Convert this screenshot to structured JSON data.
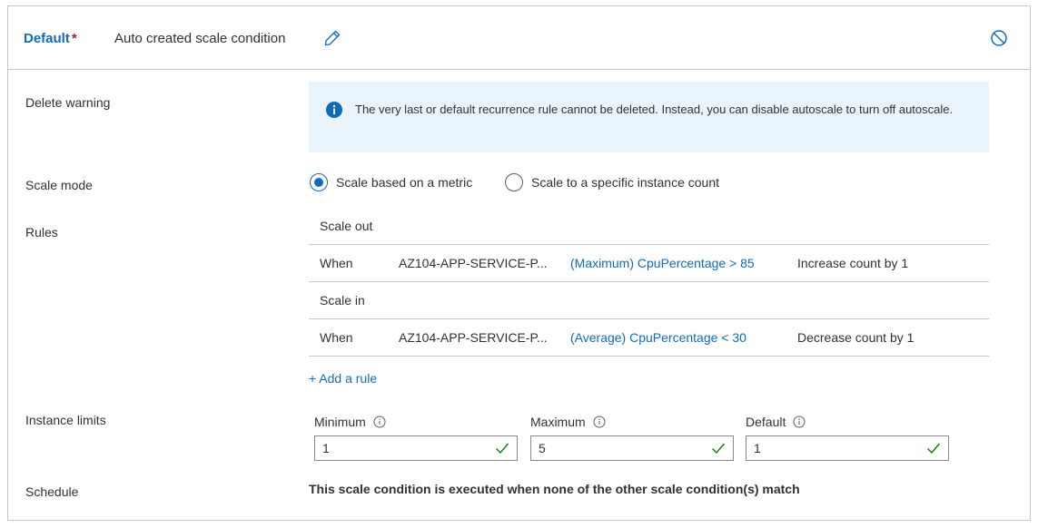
{
  "header": {
    "title": "Default",
    "required_mark": "*",
    "condition_name": "Auto created scale condition"
  },
  "labels": {
    "delete_warning": "Delete warning",
    "scale_mode": "Scale mode",
    "rules": "Rules",
    "instance_limits": "Instance limits",
    "schedule": "Schedule"
  },
  "warning": {
    "text": "The very last or default recurrence rule cannot be deleted. Instead, you can disable autoscale to turn off autoscale."
  },
  "scale_mode": {
    "options": [
      {
        "label": "Scale based on a metric",
        "selected": true
      },
      {
        "label": "Scale to a specific instance count",
        "selected": false
      }
    ]
  },
  "rules": {
    "scale_out": {
      "heading": "Scale out",
      "when": "When",
      "resource": "AZ104-APP-SERVICE-P...",
      "metric": "(Maximum) CpuPercentage > 85",
      "action": "Increase count by 1"
    },
    "scale_in": {
      "heading": "Scale in",
      "when": "When",
      "resource": "AZ104-APP-SERVICE-P...",
      "metric": "(Average) CpuPercentage < 30",
      "action": "Decrease count by 1"
    },
    "add_label": "+ Add a rule"
  },
  "instance_limits": {
    "minimum": {
      "label": "Minimum",
      "value": "1"
    },
    "maximum": {
      "label": "Maximum",
      "value": "5"
    },
    "default": {
      "label": "Default",
      "value": "1"
    }
  },
  "schedule": {
    "text": "This scale condition is executed when none of the other scale condition(s) match"
  },
  "colors": {
    "accent": "#0f6cbd",
    "required": "#a4262c",
    "valid_check": "#107c10",
    "info_bar_bg": "#eaf4fc"
  },
  "icons": [
    "pencil-icon",
    "disable-icon",
    "info-icon",
    "check-icon"
  ]
}
